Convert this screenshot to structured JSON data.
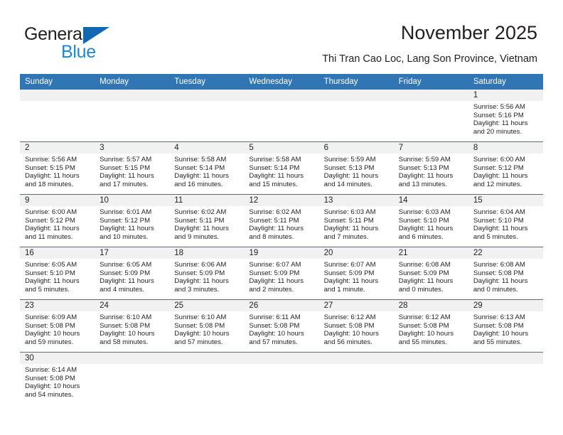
{
  "brand": {
    "name_part1": "General",
    "name_part2": "Blue",
    "triangle_color": "#1268b3",
    "blue_text_color": "#1d87d6"
  },
  "header": {
    "title": "November 2025",
    "subtitle": "Thi Tran Cao Loc, Lang Son Province, Vietnam",
    "accent_color": "#3076b5",
    "daynum_band_color": "#f1f1f1"
  },
  "weekdays": [
    "Sunday",
    "Monday",
    "Tuesday",
    "Wednesday",
    "Thursday",
    "Friday",
    "Saturday"
  ],
  "weeks": [
    [
      {
        "day": "",
        "sunrise": "",
        "sunset": "",
        "daylight": "",
        "blank": true
      },
      {
        "day": "",
        "sunrise": "",
        "sunset": "",
        "daylight": "",
        "blank": true
      },
      {
        "day": "",
        "sunrise": "",
        "sunset": "",
        "daylight": "",
        "blank": true
      },
      {
        "day": "",
        "sunrise": "",
        "sunset": "",
        "daylight": "",
        "blank": true
      },
      {
        "day": "",
        "sunrise": "",
        "sunset": "",
        "daylight": "",
        "blank": true
      },
      {
        "day": "",
        "sunrise": "",
        "sunset": "",
        "daylight": "",
        "blank": true
      },
      {
        "day": "1",
        "sunrise": "Sunrise: 5:56 AM",
        "sunset": "Sunset: 5:16 PM",
        "daylight": "Daylight: 11 hours and 20 minutes."
      }
    ],
    [
      {
        "day": "2",
        "sunrise": "Sunrise: 5:56 AM",
        "sunset": "Sunset: 5:15 PM",
        "daylight": "Daylight: 11 hours and 18 minutes."
      },
      {
        "day": "3",
        "sunrise": "Sunrise: 5:57 AM",
        "sunset": "Sunset: 5:15 PM",
        "daylight": "Daylight: 11 hours and 17 minutes."
      },
      {
        "day": "4",
        "sunrise": "Sunrise: 5:58 AM",
        "sunset": "Sunset: 5:14 PM",
        "daylight": "Daylight: 11 hours and 16 minutes."
      },
      {
        "day": "5",
        "sunrise": "Sunrise: 5:58 AM",
        "sunset": "Sunset: 5:14 PM",
        "daylight": "Daylight: 11 hours and 15 minutes."
      },
      {
        "day": "6",
        "sunrise": "Sunrise: 5:59 AM",
        "sunset": "Sunset: 5:13 PM",
        "daylight": "Daylight: 11 hours and 14 minutes."
      },
      {
        "day": "7",
        "sunrise": "Sunrise: 5:59 AM",
        "sunset": "Sunset: 5:13 PM",
        "daylight": "Daylight: 11 hours and 13 minutes."
      },
      {
        "day": "8",
        "sunrise": "Sunrise: 6:00 AM",
        "sunset": "Sunset: 5:12 PM",
        "daylight": "Daylight: 11 hours and 12 minutes."
      }
    ],
    [
      {
        "day": "9",
        "sunrise": "Sunrise: 6:00 AM",
        "sunset": "Sunset: 5:12 PM",
        "daylight": "Daylight: 11 hours and 11 minutes."
      },
      {
        "day": "10",
        "sunrise": "Sunrise: 6:01 AM",
        "sunset": "Sunset: 5:12 PM",
        "daylight": "Daylight: 11 hours and 10 minutes."
      },
      {
        "day": "11",
        "sunrise": "Sunrise: 6:02 AM",
        "sunset": "Sunset: 5:11 PM",
        "daylight": "Daylight: 11 hours and 9 minutes."
      },
      {
        "day": "12",
        "sunrise": "Sunrise: 6:02 AM",
        "sunset": "Sunset: 5:11 PM",
        "daylight": "Daylight: 11 hours and 8 minutes."
      },
      {
        "day": "13",
        "sunrise": "Sunrise: 6:03 AM",
        "sunset": "Sunset: 5:11 PM",
        "daylight": "Daylight: 11 hours and 7 minutes."
      },
      {
        "day": "14",
        "sunrise": "Sunrise: 6:03 AM",
        "sunset": "Sunset: 5:10 PM",
        "daylight": "Daylight: 11 hours and 6 minutes."
      },
      {
        "day": "15",
        "sunrise": "Sunrise: 6:04 AM",
        "sunset": "Sunset: 5:10 PM",
        "daylight": "Daylight: 11 hours and 5 minutes."
      }
    ],
    [
      {
        "day": "16",
        "sunrise": "Sunrise: 6:05 AM",
        "sunset": "Sunset: 5:10 PM",
        "daylight": "Daylight: 11 hours and 5 minutes."
      },
      {
        "day": "17",
        "sunrise": "Sunrise: 6:05 AM",
        "sunset": "Sunset: 5:09 PM",
        "daylight": "Daylight: 11 hours and 4 minutes."
      },
      {
        "day": "18",
        "sunrise": "Sunrise: 6:06 AM",
        "sunset": "Sunset: 5:09 PM",
        "daylight": "Daylight: 11 hours and 3 minutes."
      },
      {
        "day": "19",
        "sunrise": "Sunrise: 6:07 AM",
        "sunset": "Sunset: 5:09 PM",
        "daylight": "Daylight: 11 hours and 2 minutes."
      },
      {
        "day": "20",
        "sunrise": "Sunrise: 6:07 AM",
        "sunset": "Sunset: 5:09 PM",
        "daylight": "Daylight: 11 hours and 1 minute."
      },
      {
        "day": "21",
        "sunrise": "Sunrise: 6:08 AM",
        "sunset": "Sunset: 5:09 PM",
        "daylight": "Daylight: 11 hours and 0 minutes."
      },
      {
        "day": "22",
        "sunrise": "Sunrise: 6:08 AM",
        "sunset": "Sunset: 5:08 PM",
        "daylight": "Daylight: 11 hours and 0 minutes."
      }
    ],
    [
      {
        "day": "23",
        "sunrise": "Sunrise: 6:09 AM",
        "sunset": "Sunset: 5:08 PM",
        "daylight": "Daylight: 10 hours and 59 minutes."
      },
      {
        "day": "24",
        "sunrise": "Sunrise: 6:10 AM",
        "sunset": "Sunset: 5:08 PM",
        "daylight": "Daylight: 10 hours and 58 minutes."
      },
      {
        "day": "25",
        "sunrise": "Sunrise: 6:10 AM",
        "sunset": "Sunset: 5:08 PM",
        "daylight": "Daylight: 10 hours and 57 minutes."
      },
      {
        "day": "26",
        "sunrise": "Sunrise: 6:11 AM",
        "sunset": "Sunset: 5:08 PM",
        "daylight": "Daylight: 10 hours and 57 minutes."
      },
      {
        "day": "27",
        "sunrise": "Sunrise: 6:12 AM",
        "sunset": "Sunset: 5:08 PM",
        "daylight": "Daylight: 10 hours and 56 minutes."
      },
      {
        "day": "28",
        "sunrise": "Sunrise: 6:12 AM",
        "sunset": "Sunset: 5:08 PM",
        "daylight": "Daylight: 10 hours and 55 minutes."
      },
      {
        "day": "29",
        "sunrise": "Sunrise: 6:13 AM",
        "sunset": "Sunset: 5:08 PM",
        "daylight": "Daylight: 10 hours and 55 minutes."
      }
    ],
    [
      {
        "day": "30",
        "sunrise": "Sunrise: 6:14 AM",
        "sunset": "Sunset: 5:08 PM",
        "daylight": "Daylight: 10 hours and 54 minutes."
      },
      {
        "day": "",
        "sunrise": "",
        "sunset": "",
        "daylight": "",
        "blank": true
      },
      {
        "day": "",
        "sunrise": "",
        "sunset": "",
        "daylight": "",
        "blank": true
      },
      {
        "day": "",
        "sunrise": "",
        "sunset": "",
        "daylight": "",
        "blank": true
      },
      {
        "day": "",
        "sunrise": "",
        "sunset": "",
        "daylight": "",
        "blank": true
      },
      {
        "day": "",
        "sunrise": "",
        "sunset": "",
        "daylight": "",
        "blank": true
      },
      {
        "day": "",
        "sunrise": "",
        "sunset": "",
        "daylight": "",
        "blank": true
      }
    ]
  ]
}
